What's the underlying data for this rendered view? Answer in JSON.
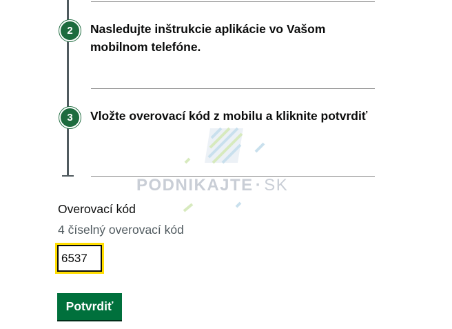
{
  "steps": [
    {
      "number": "2",
      "text": "Nasledujte inštrukcie aplikácie vo Vašom mobilnom telefóne."
    },
    {
      "number": "3",
      "text": "Vložte overovací kód z mobilu a kliknite potvrdiť"
    }
  ],
  "watermark": {
    "name": "PODNIKAJTE",
    "separator": "·",
    "suffix": "SK"
  },
  "code_field": {
    "label": "Overovací kód",
    "hint": "4 číselný overovací kód",
    "value": "6537"
  },
  "submit_label": "Potvrdiť",
  "colors": {
    "brand_green": "#00703c",
    "focus_yellow": "#ffdd00",
    "hint_grey": "#505a5f"
  }
}
